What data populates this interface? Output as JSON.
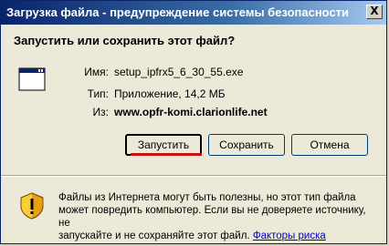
{
  "window": {
    "title": "Загрузка файла - предупреждение системы безопасности",
    "close_label": "X"
  },
  "prompt": {
    "question": "Запустить или сохранить этот файл?"
  },
  "file": {
    "name_label": "Имя:",
    "name_value": "setup_ipfrx5_6_30_55.exe",
    "type_label": "Тип:",
    "type_value": "Приложение, 14,2 МБ",
    "from_label": "Из:",
    "from_value": "www.opfr-komi.clarionlife.net",
    "icon": "application-window-icon"
  },
  "buttons": {
    "run": "Запустить",
    "save": "Сохранить",
    "cancel": "Отмена"
  },
  "warning": {
    "icon": "shield-warning-icon",
    "line1": "Файлы из Интернета могут быть полезны, но этот тип файла",
    "line2": "может повредить компьютер. Если вы не доверяете источнику, не",
    "line3": "запускайте и не сохраняйте этот файл.",
    "link": "Факторы риска"
  },
  "colors": {
    "title_bar": "#0a246a",
    "dialog_bg": "#ece9d8",
    "link": "#0000cc",
    "highlight_underline": "#cc1111"
  }
}
